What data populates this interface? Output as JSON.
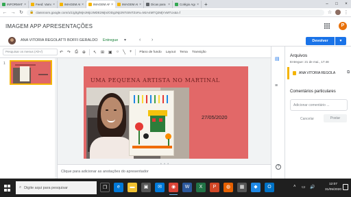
{
  "browser": {
    "tabs": [
      {
        "title": "INFORMATICA_N",
        "favicon_color": "#34a853"
      },
      {
        "title": "Feed: Vamos abr",
        "favicon_color": "#f4b400"
      },
      {
        "title": "IMAGEM APP AP",
        "favicon_color": "#f4b400"
      },
      {
        "title": "IMAGEM APP AP",
        "favicon_color": "#f4b400",
        "active": true
      },
      {
        "title": "IMAGEM APP AP",
        "favicon_color": "#f4b400"
      },
      {
        "title": "Dicas para prepar",
        "favicon_color": "#5f6368"
      },
      {
        "title": "Colégio Agostinho",
        "favicon_color": "#34a853"
      }
    ],
    "new_tab": "+",
    "url": "classroom.google.com/u/1/g/tg/MjAzMjczMDE2MjIx/ODgzNjI2NTc5NTZo#u=MzA4MTQ2MjYxMTUx&t=f"
  },
  "header": {
    "close": "×",
    "title": "IMAGEM APP APRESENTAÇÕES",
    "avatar_letter": "P"
  },
  "student": {
    "name": "ANA VITORIA REGOLATTI BOFFI GERALDO",
    "status": "Entregue",
    "dropdown": "▾",
    "prev": "‹",
    "next": "›",
    "return_button": "Devolver",
    "return_dropdown": "▾"
  },
  "toolbar": {
    "search_placeholder": "Pesquisar os menus (Alt+/)",
    "undo": "↶",
    "redo": "↷",
    "print": "⎙",
    "paint": "🖌",
    "zoom": "⊕",
    "select": "↖",
    "textbox": "⊞",
    "image": "▣",
    "shape": "○",
    "line": "╲",
    "comment": "+",
    "background": "Plano de fundo",
    "layout": "Layout",
    "theme": "Tema",
    "transition": "Transição"
  },
  "filmstrip": {
    "slide_number": "1"
  },
  "slide": {
    "title": "UMA PEQUENA ARTISTA  NO MARTINAL",
    "date": "27/05/2020"
  },
  "notes": {
    "placeholder": "Clique para adicionar as anotações do apresentador",
    "button": "▪"
  },
  "panel": {
    "files_heading": "Arquivos",
    "delivered_info": "Entregue: 21 de mai., 17:48",
    "file_name": "ANA VITORIA REGOLA",
    "open_icon": "⧉",
    "comments_heading": "Comentários particulares",
    "comment_placeholder": "Adicionar comentário ...",
    "cancel": "Cancelar",
    "post": "Postar",
    "help": "?"
  },
  "taskbar": {
    "search_placeholder": "Digite aqui para pesquisar",
    "time": "12:07",
    "date": "31/05/2020",
    "apps": [
      {
        "icon": "task-view-icon",
        "glyph": "❐",
        "color": "#1f1f1f"
      },
      {
        "icon": "edge-icon",
        "glyph": "e",
        "color": "#0078d7"
      },
      {
        "icon": "file-explorer-icon",
        "glyph": "▬",
        "color": "#f2c230"
      },
      {
        "icon": "store-icon",
        "glyph": "▣",
        "color": "#555"
      },
      {
        "icon": "mail-icon",
        "glyph": "✉",
        "color": "#0078d7"
      },
      {
        "icon": "chrome-icon",
        "glyph": "◉",
        "color": "#db4437"
      },
      {
        "icon": "word-icon",
        "glyph": "W",
        "color": "#2b579a"
      },
      {
        "icon": "excel-icon",
        "glyph": "X",
        "color": "#217346"
      },
      {
        "icon": "powerpoint-icon",
        "glyph": "P",
        "color": "#d24726"
      },
      {
        "icon": "firefox-icon",
        "glyph": "◍",
        "color": "#e66000"
      },
      {
        "icon": "photos-icon",
        "glyph": "▦",
        "color": "#555"
      },
      {
        "icon": "app-icon",
        "glyph": "◆",
        "color": "#1e88e5"
      },
      {
        "icon": "outlook-icon",
        "glyph": "O",
        "color": "#0072c6"
      }
    ]
  },
  "colors": {
    "accent": "#1a73e8",
    "slide_bg": "#e26868",
    "delivered_green": "#188038"
  }
}
